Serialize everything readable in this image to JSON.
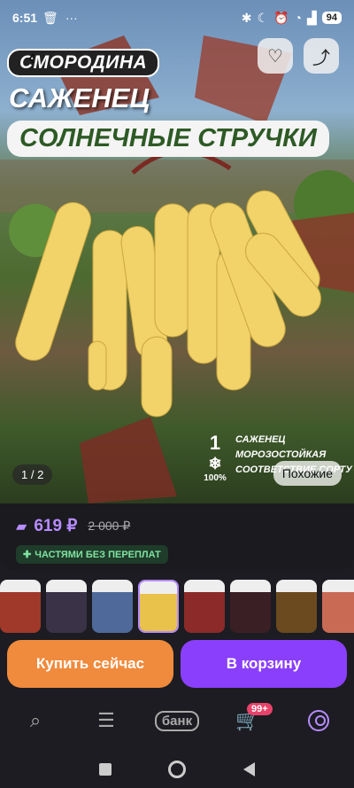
{
  "status_bar": {
    "time": "6:51",
    "battery": "94"
  },
  "hero": {
    "tag_line1": "СМОРОДИНА",
    "tag_line2": "САЖЕНЕЦ",
    "tag_line3": "СОЛНЕЧНЫЕ СТРУЧКИ",
    "feature_number": "1",
    "feature_percent": "100%",
    "feature_line1": "САЖЕНЕЦ",
    "feature_line2": "МОРОЗОСТОЙКАЯ",
    "feature_line3": "СООТВЕТСТВИЕ СОРТУ",
    "counter": "1 / 2",
    "similar_label": "Похожие"
  },
  "price": {
    "current": "619 ₽",
    "old": "2 000 ₽",
    "installment": "ЧАСТЯМИ БЕЗ ПЕРЕПЛАТ"
  },
  "thumbnails": [
    {
      "color": "#a0392a"
    },
    {
      "color": "#3a3246"
    },
    {
      "color": "#4f6a9a"
    },
    {
      "color": "#e8c24a"
    },
    {
      "color": "#8c2a2a"
    },
    {
      "color": "#3a1f24"
    },
    {
      "color": "#6b4a1f"
    },
    {
      "color": "#c96a55"
    },
    {
      "color": "#a04830"
    }
  ],
  "actions": {
    "buy_now": "Купить сейчас",
    "add_to_cart": "В корзину"
  },
  "tabbar": {
    "bank_label": "банк",
    "cart_badge": "99+"
  }
}
